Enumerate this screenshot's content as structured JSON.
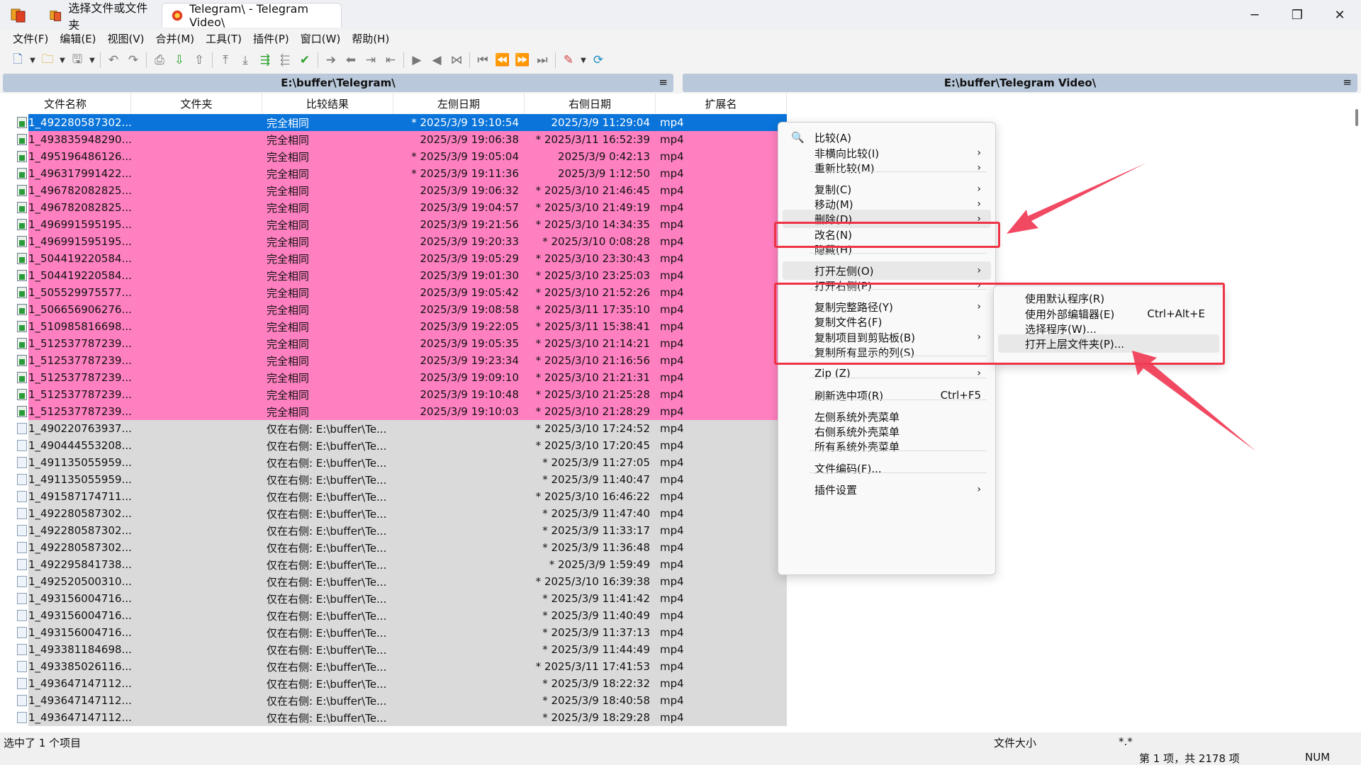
{
  "window": {
    "tab_inactive": "选择文件或文件夹",
    "tab_active": "Telegram\\ - Telegram Video\\",
    "minimize": "─",
    "maximize": "❐",
    "close": "✕"
  },
  "menubar": [
    "文件(F)",
    "编辑(E)",
    "视图(V)",
    "合并(M)",
    "工具(T)",
    "插件(P)",
    "窗口(W)",
    "帮助(H)"
  ],
  "paths": {
    "left": "E:\\buffer\\Telegram\\",
    "right": "E:\\buffer\\Telegram Video\\",
    "menu_glyph": "≡"
  },
  "columns": {
    "name": "文件名称",
    "folder": "文件夹",
    "result": "比较结果",
    "left_date": "左侧日期",
    "right_date": "右侧日期",
    "ext": "扩展名"
  },
  "rows": [
    {
      "name": "1_492280587302...",
      "result": "完全相同",
      "left": "* 2025/3/9 19:10:54",
      "right": "2025/3/9 11:29:04",
      "ext": "mp4",
      "state": "sel"
    },
    {
      "name": "1_493835948290...",
      "result": "完全相同",
      "left": "2025/3/9 19:06:38",
      "right": "* 2025/3/11 16:52:39",
      "ext": "mp4",
      "state": "pink"
    },
    {
      "name": "1_495196486126...",
      "result": "完全相同",
      "left": "* 2025/3/9 19:05:04",
      "right": "2025/3/9 0:42:13",
      "ext": "mp4",
      "state": "pink"
    },
    {
      "name": "1_496317991422...",
      "result": "完全相同",
      "left": "* 2025/3/9 19:11:36",
      "right": "2025/3/9 1:12:50",
      "ext": "mp4",
      "state": "pink"
    },
    {
      "name": "1_496782082825...",
      "result": "完全相同",
      "left": "2025/3/9 19:06:32",
      "right": "* 2025/3/10 21:46:45",
      "ext": "mp4",
      "state": "pink"
    },
    {
      "name": "1_496782082825...",
      "result": "完全相同",
      "left": "2025/3/9 19:04:57",
      "right": "* 2025/3/10 21:49:19",
      "ext": "mp4",
      "state": "pink"
    },
    {
      "name": "1_496991595195...",
      "result": "完全相同",
      "left": "2025/3/9 19:21:56",
      "right": "* 2025/3/10 14:34:35",
      "ext": "mp4",
      "state": "pink"
    },
    {
      "name": "1_496991595195...",
      "result": "完全相同",
      "left": "2025/3/9 19:20:33",
      "right": "* 2025/3/10 0:08:28",
      "ext": "mp4",
      "state": "pink"
    },
    {
      "name": "1_504419220584...",
      "result": "完全相同",
      "left": "2025/3/9 19:05:29",
      "right": "* 2025/3/10 23:30:43",
      "ext": "mp4",
      "state": "pink"
    },
    {
      "name": "1_504419220584...",
      "result": "完全相同",
      "left": "2025/3/9 19:01:30",
      "right": "* 2025/3/10 23:25:03",
      "ext": "mp4",
      "state": "pink"
    },
    {
      "name": "1_505529975577...",
      "result": "完全相同",
      "left": "2025/3/9 19:05:42",
      "right": "* 2025/3/10 21:52:26",
      "ext": "mp4",
      "state": "pink"
    },
    {
      "name": "1_506656906276...",
      "result": "完全相同",
      "left": "2025/3/9 19:08:58",
      "right": "* 2025/3/11 17:35:10",
      "ext": "mp4",
      "state": "pink"
    },
    {
      "name": "1_510985816698...",
      "result": "完全相同",
      "left": "2025/3/9 19:22:05",
      "right": "* 2025/3/11 15:38:41",
      "ext": "mp4",
      "state": "pink"
    },
    {
      "name": "1_512537787239...",
      "result": "完全相同",
      "left": "2025/3/9 19:05:35",
      "right": "* 2025/3/10 21:14:21",
      "ext": "mp4",
      "state": "pink"
    },
    {
      "name": "1_512537787239...",
      "result": "完全相同",
      "left": "2025/3/9 19:23:34",
      "right": "* 2025/3/10 21:16:56",
      "ext": "mp4",
      "state": "pink"
    },
    {
      "name": "1_512537787239...",
      "result": "完全相同",
      "left": "2025/3/9 19:09:10",
      "right": "* 2025/3/10 21:21:31",
      "ext": "mp4",
      "state": "pink"
    },
    {
      "name": "1_512537787239...",
      "result": "完全相同",
      "left": "2025/3/9 19:10:48",
      "right": "* 2025/3/10 21:25:28",
      "ext": "mp4",
      "state": "pink"
    },
    {
      "name": "1_512537787239...",
      "result": "完全相同",
      "left": "2025/3/9 19:10:03",
      "right": "* 2025/3/10 21:28:29",
      "ext": "mp4",
      "state": "pink"
    },
    {
      "name": "1_490220763937...",
      "result": "仅在右侧:  E:\\buffer\\Te...",
      "left": "",
      "right": "* 2025/3/10 17:24:52",
      "ext": "mp4",
      "state": "gray"
    },
    {
      "name": "1_490444553208...",
      "result": "仅在右侧:  E:\\buffer\\Te...",
      "left": "",
      "right": "* 2025/3/10 17:20:45",
      "ext": "mp4",
      "state": "gray"
    },
    {
      "name": "1_491135055959...",
      "result": "仅在右侧:  E:\\buffer\\Te...",
      "left": "",
      "right": "* 2025/3/9 11:27:05",
      "ext": "mp4",
      "state": "gray"
    },
    {
      "name": "1_491135055959...",
      "result": "仅在右侧:  E:\\buffer\\Te...",
      "left": "",
      "right": "* 2025/3/9 11:40:47",
      "ext": "mp4",
      "state": "gray"
    },
    {
      "name": "1_491587174711...",
      "result": "仅在右侧:  E:\\buffer\\Te...",
      "left": "",
      "right": "* 2025/3/10 16:46:22",
      "ext": "mp4",
      "state": "gray"
    },
    {
      "name": "1_492280587302...",
      "result": "仅在右侧:  E:\\buffer\\Te...",
      "left": "",
      "right": "* 2025/3/9 11:47:40",
      "ext": "mp4",
      "state": "gray"
    },
    {
      "name": "1_492280587302...",
      "result": "仅在右侧:  E:\\buffer\\Te...",
      "left": "",
      "right": "* 2025/3/9 11:33:17",
      "ext": "mp4",
      "state": "gray"
    },
    {
      "name": "1_492280587302...",
      "result": "仅在右侧:  E:\\buffer\\Te...",
      "left": "",
      "right": "* 2025/3/9 11:36:48",
      "ext": "mp4",
      "state": "gray"
    },
    {
      "name": "1_492295841738...",
      "result": "仅在右侧:  E:\\buffer\\Te...",
      "left": "",
      "right": "* 2025/3/9 1:59:49",
      "ext": "mp4",
      "state": "gray"
    },
    {
      "name": "1_492520500310...",
      "result": "仅在右侧:  E:\\buffer\\Te...",
      "left": "",
      "right": "* 2025/3/10 16:39:38",
      "ext": "mp4",
      "state": "gray"
    },
    {
      "name": "1_493156004716...",
      "result": "仅在右侧:  E:\\buffer\\Te...",
      "left": "",
      "right": "* 2025/3/9 11:41:42",
      "ext": "mp4",
      "state": "gray"
    },
    {
      "name": "1_493156004716...",
      "result": "仅在右侧:  E:\\buffer\\Te...",
      "left": "",
      "right": "* 2025/3/9 11:40:49",
      "ext": "mp4",
      "state": "gray"
    },
    {
      "name": "1_493156004716...",
      "result": "仅在右侧:  E:\\buffer\\Te...",
      "left": "",
      "right": "* 2025/3/9 11:37:13",
      "ext": "mp4",
      "state": "gray"
    },
    {
      "name": "1_493381184698...",
      "result": "仅在右侧:  E:\\buffer\\Te...",
      "left": "",
      "right": "* 2025/3/9 11:44:49",
      "ext": "mp4",
      "state": "gray"
    },
    {
      "name": "1_493385026116...",
      "result": "仅在右侧:  E:\\buffer\\Te...",
      "left": "",
      "right": "* 2025/3/11 17:41:53",
      "ext": "mp4",
      "state": "gray"
    },
    {
      "name": "1_493647147112...",
      "result": "仅在右侧:  E:\\buffer\\Te...",
      "left": "",
      "right": "* 2025/3/9 18:22:32",
      "ext": "mp4",
      "state": "gray"
    },
    {
      "name": "1_493647147112...",
      "result": "仅在右侧:  E:\\buffer\\Te...",
      "left": "",
      "right": "* 2025/3/9 18:40:58",
      "ext": "mp4",
      "state": "gray"
    },
    {
      "name": "1_493647147112...",
      "result": "仅在右侧:  E:\\buffer\\Te...",
      "left": "",
      "right": "* 2025/3/9 18:29:28",
      "ext": "mp4",
      "state": "gray"
    }
  ],
  "context_menu": {
    "items": [
      {
        "label": "比较(A)",
        "arrow": "",
        "shortcut": "",
        "icon": "magnifier-icon"
      },
      {
        "label": "非横向比较(I)",
        "arrow": "›",
        "shortcut": ""
      },
      {
        "label": "重新比较(M)",
        "arrow": "›",
        "shortcut": ""
      },
      {
        "label": "复制(C)",
        "arrow": "›",
        "shortcut": ""
      },
      {
        "label": "移动(M)",
        "arrow": "›",
        "shortcut": ""
      },
      {
        "label": "删除(D)",
        "arrow": "›",
        "shortcut": ""
      },
      {
        "label": "改名(N)",
        "arrow": "",
        "shortcut": ""
      },
      {
        "label": "隐藏(H)",
        "arrow": "",
        "shortcut": ""
      },
      {
        "label": "打开左侧(O)",
        "arrow": "›",
        "shortcut": ""
      },
      {
        "label": "打开右侧(P)",
        "arrow": "›",
        "shortcut": ""
      },
      {
        "label": "复制完整路径(Y)",
        "arrow": "›",
        "shortcut": ""
      },
      {
        "label": "复制文件名(F)",
        "arrow": "",
        "shortcut": ""
      },
      {
        "label": "复制项目到剪贴板(B)",
        "arrow": "›",
        "shortcut": ""
      },
      {
        "label": "复制所有显示的列(S)",
        "arrow": "",
        "shortcut": ""
      },
      {
        "label": "Zip (Z)",
        "arrow": "›",
        "shortcut": ""
      },
      {
        "label": "刷新选中项(R)",
        "arrow": "",
        "shortcut": "Ctrl+F5"
      },
      {
        "label": "左侧系统外壳菜单",
        "arrow": "",
        "shortcut": ""
      },
      {
        "label": "右侧系统外壳菜单",
        "arrow": "",
        "shortcut": ""
      },
      {
        "label": "所有系统外壳菜单",
        "arrow": "",
        "shortcut": ""
      },
      {
        "label": "文件编码(F)...",
        "arrow": "",
        "shortcut": ""
      },
      {
        "label": "插件设置",
        "arrow": "›",
        "shortcut": ""
      }
    ]
  },
  "submenu": {
    "items": [
      {
        "label": "使用默认程序(R)",
        "shortcut": ""
      },
      {
        "label": "使用外部编辑器(E)",
        "shortcut": "Ctrl+Alt+E"
      },
      {
        "label": "选择程序(W)...",
        "shortcut": ""
      },
      {
        "label": "打开上层文件夹(P)...",
        "shortcut": ""
      }
    ]
  },
  "status": {
    "selection": "选中了 1 个项目",
    "file_size": "文件大小",
    "filter": "*.*",
    "count": "第 1 项，共 2178 项",
    "num": "NUM"
  },
  "colors": {
    "identical_row": "#ff80c0",
    "selected_row": "#0a74da",
    "right_only_row": "#dadada",
    "path_header": "#b9c8da",
    "annotation_red": "#ee3344"
  }
}
